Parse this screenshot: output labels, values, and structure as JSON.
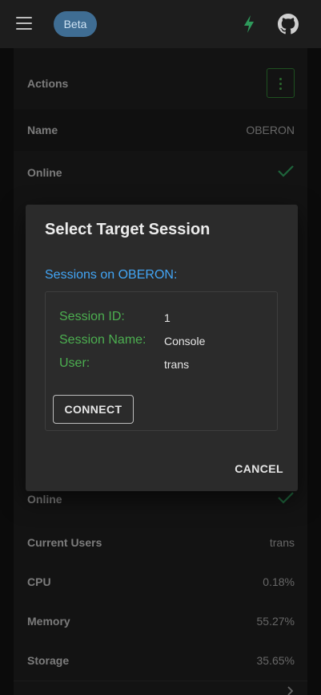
{
  "appbar": {
    "beta_label": "Beta",
    "icons": [
      "menu-icon",
      "bolt-icon",
      "github-icon"
    ]
  },
  "device": {
    "actions_label": "Actions",
    "name_label": "Name",
    "name_value": "OBERON",
    "online_label": "Online"
  },
  "stats": [
    {
      "label": "Online",
      "value": ""
    },
    {
      "label": "Current Users",
      "value": "trans"
    },
    {
      "label": "CPU",
      "value": "0.18%"
    },
    {
      "label": "Memory",
      "value": "55.27%"
    },
    {
      "label": "Storage",
      "value": "35.65%"
    }
  ],
  "dialog": {
    "title": "Select Target Session",
    "heading": "Sessions on OBERON:",
    "session": {
      "id_label": "Session ID:",
      "id_value": "1",
      "name_label": "Session Name:",
      "name_value": "Console",
      "user_label": "User:",
      "user_value": "trans"
    },
    "connect_label": "CONNECT",
    "cancel_label": "CANCEL"
  },
  "colors": {
    "accent_green": "#4caf50",
    "link_blue": "#42a5f5",
    "beta_chip": "#3f6d93"
  }
}
